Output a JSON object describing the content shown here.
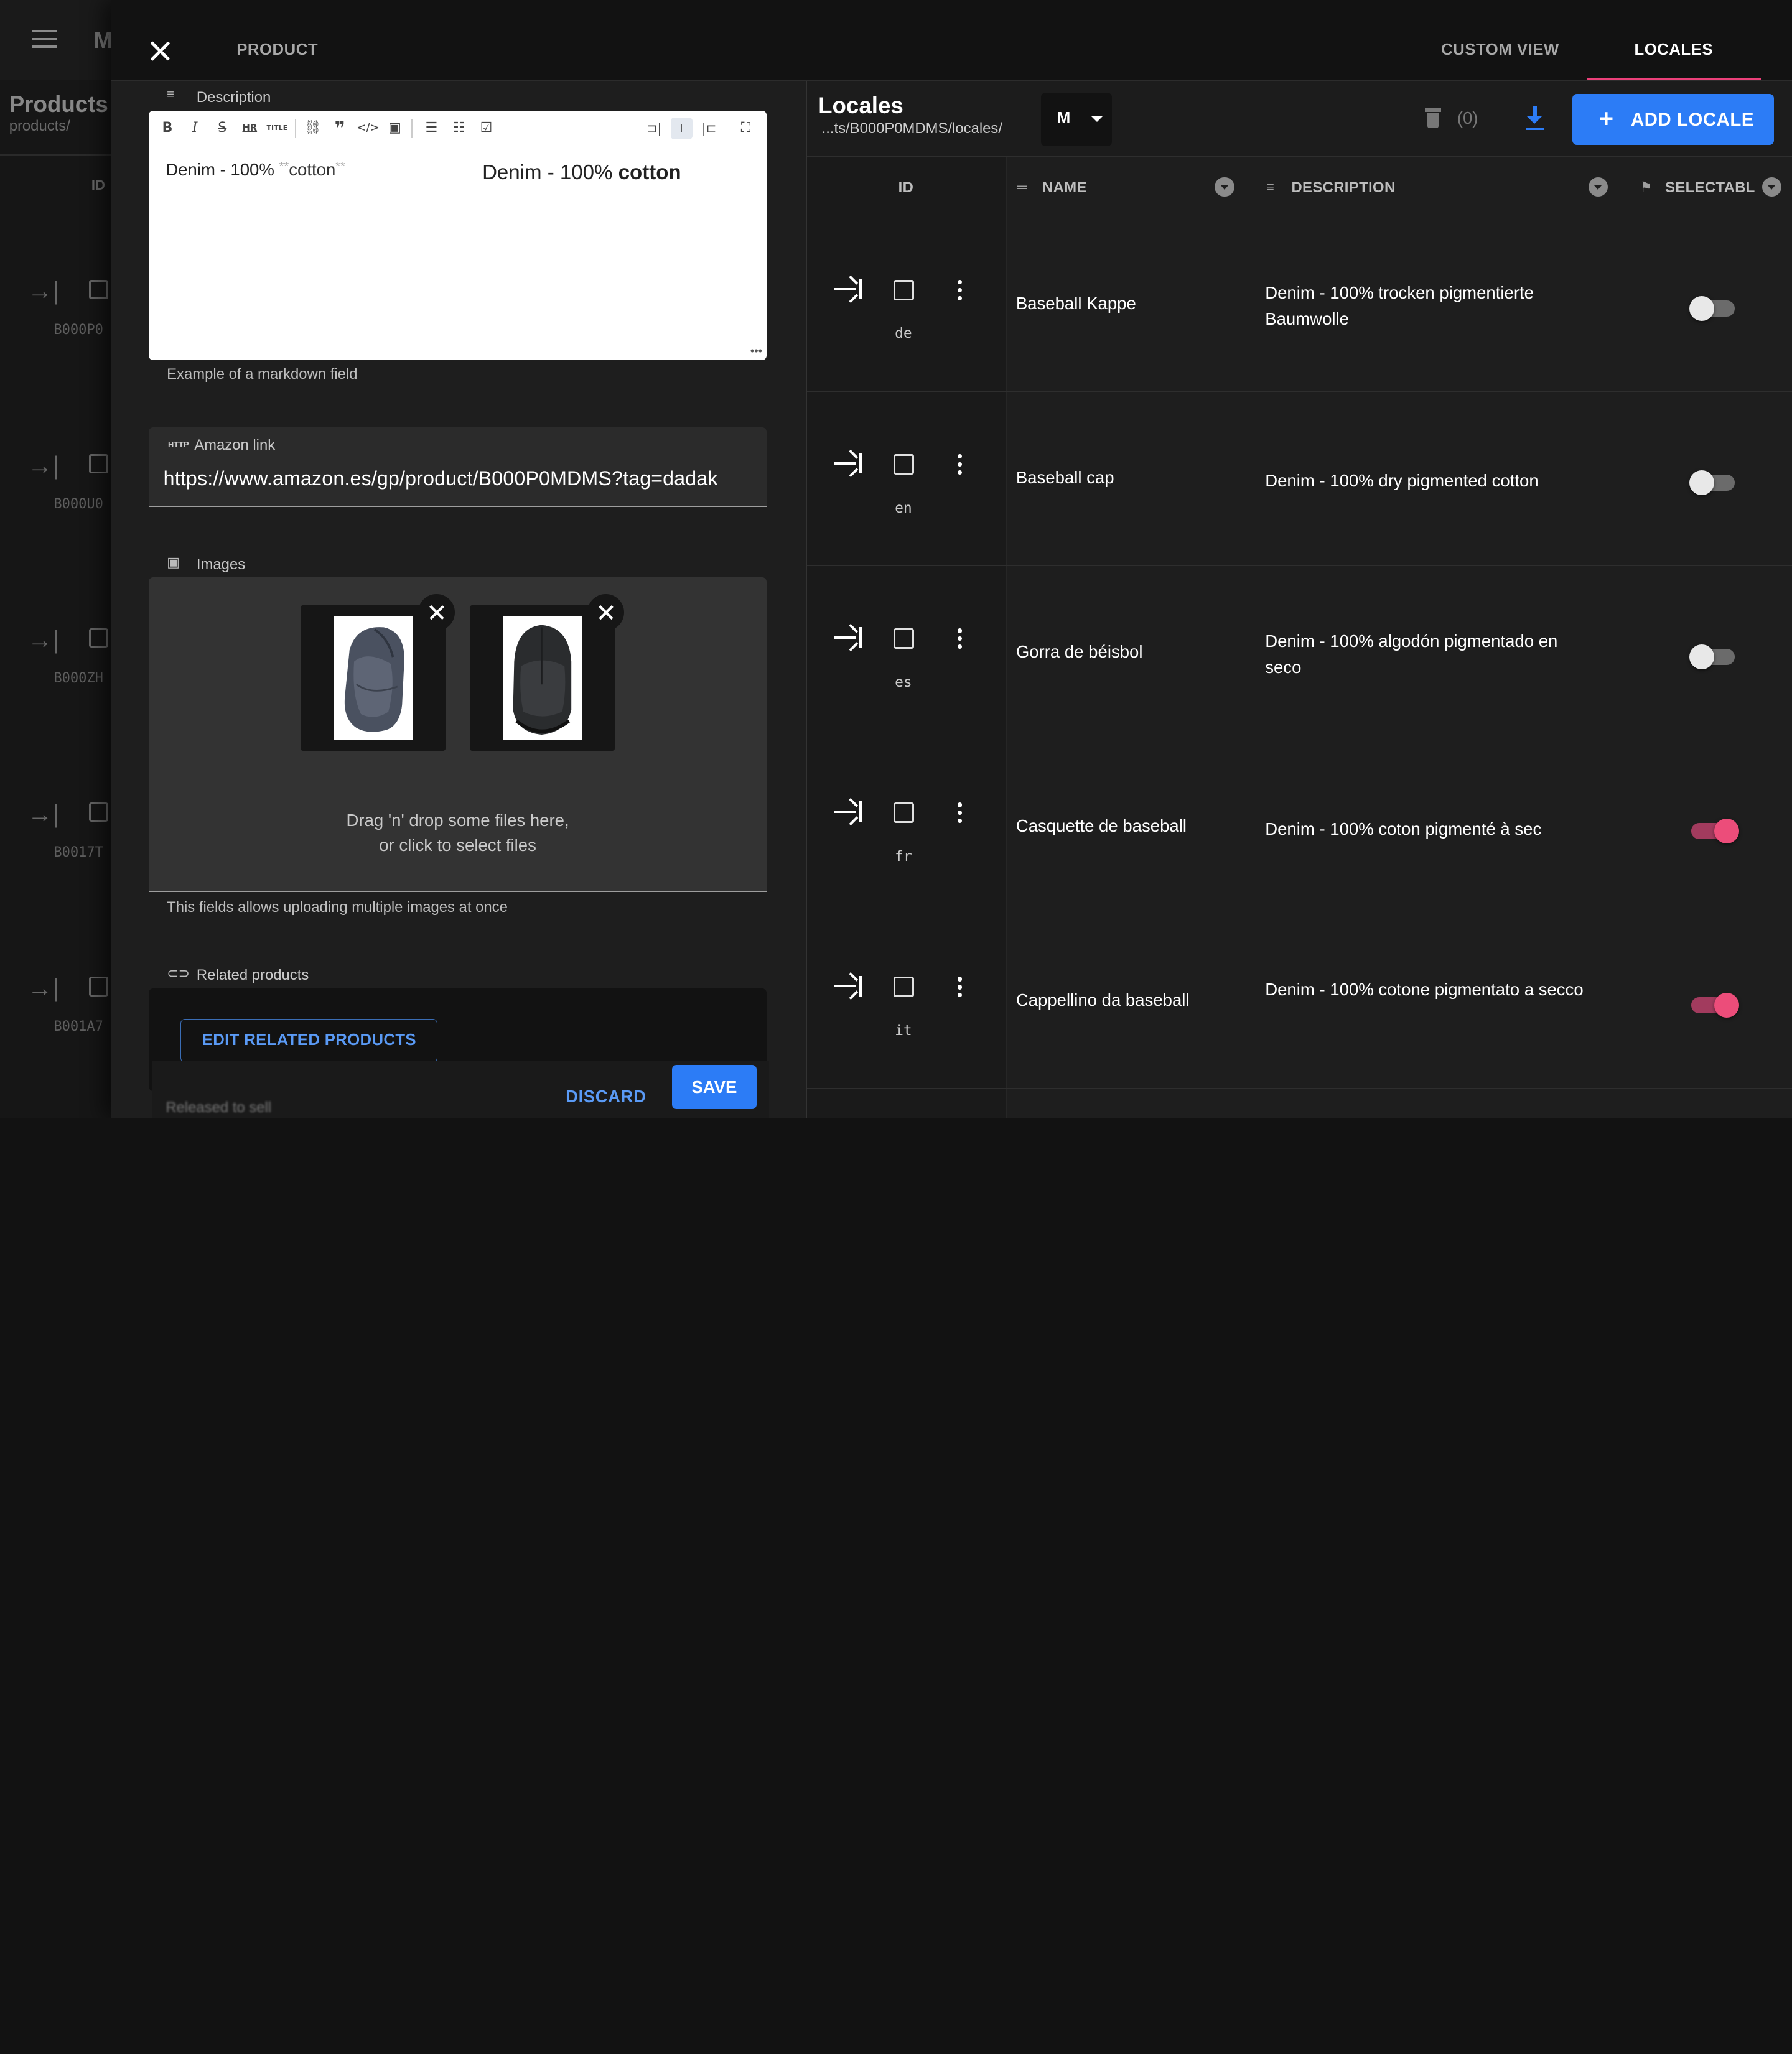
{
  "background_app": {
    "app_letter": "M",
    "title": "Products",
    "path": "products/",
    "id_header": "ID",
    "row_ids": [
      "B000P0",
      "B000U0",
      "B000ZH",
      "B0017T",
      "B001A7"
    ],
    "open_glyph": "→|"
  },
  "drawer": {
    "tabs": {
      "product": "PRODUCT",
      "custom_view": "CUSTOM VIEW",
      "locales": "LOCALES",
      "active": "LOCALES"
    },
    "accent_color": "#ec407a"
  },
  "form": {
    "description": {
      "label": "Description",
      "source_text": "Denim - 100% ",
      "source_md_open": "**",
      "source_md_word": "cotton",
      "source_md_close": "**",
      "preview_plain": "Denim - 100% ",
      "preview_bold": "cotton",
      "helper": "Example of a markdown field",
      "toolbar": [
        "B",
        "I",
        "S",
        "HR",
        "TITLE",
        "link",
        "quote",
        "code",
        "image",
        "bullet-list",
        "numbered-list",
        "checklist",
        "editor-only",
        "split-view",
        "preview-only",
        "fullscreen"
      ]
    },
    "amazon_link": {
      "icon": "HTTP",
      "label": "Amazon link",
      "value": "https://www.amazon.es/gp/product/B000P0MDMS?tag=dadak"
    },
    "images": {
      "label": "Images",
      "dropzone_line1": "Drag 'n' drop some files here,",
      "dropzone_line2": "or click to select files",
      "helper": "This fields allows uploading multiple images at once"
    },
    "related_products": {
      "label": "Related products",
      "button": "EDIT RELATED PRODUCTS"
    },
    "actions": {
      "discard": "DISCARD",
      "save": "SAVE"
    },
    "faded_next_label": "Released to sell"
  },
  "locales": {
    "title": "Locales",
    "path": "...ts/B000P0MDMS/locales/",
    "size_select": "M",
    "selected_count": "(0)",
    "add_button": "ADD LOCALE",
    "columns": {
      "id": "ID",
      "name": "NAME",
      "description": "DESCRIPTION",
      "selectable": "SELECTABL"
    },
    "rows": [
      {
        "id": "de",
        "name": "Baseball Kappe",
        "description": "Denim - 100% trocken pigmentierte Baumwolle",
        "selectable": false
      },
      {
        "id": "en",
        "name": "Baseball cap",
        "description": "Denim - 100% dry pigmented cotton",
        "selectable": false
      },
      {
        "id": "es",
        "name": "Gorra de béisbol",
        "description": "Denim - 100% algodón pigmentado en seco",
        "selectable": false
      },
      {
        "id": "fr",
        "name": "Casquette de baseball",
        "description": "Denim - 100% coton pigmenté à sec",
        "selectable": true
      },
      {
        "id": "it",
        "name": "Cappellino da baseball",
        "description": "Denim - 100% cotone pigmentato a secco",
        "selectable": true
      }
    ],
    "primary_color": "#2c7cf6",
    "toggle_on_color": "#ec4d7a"
  }
}
